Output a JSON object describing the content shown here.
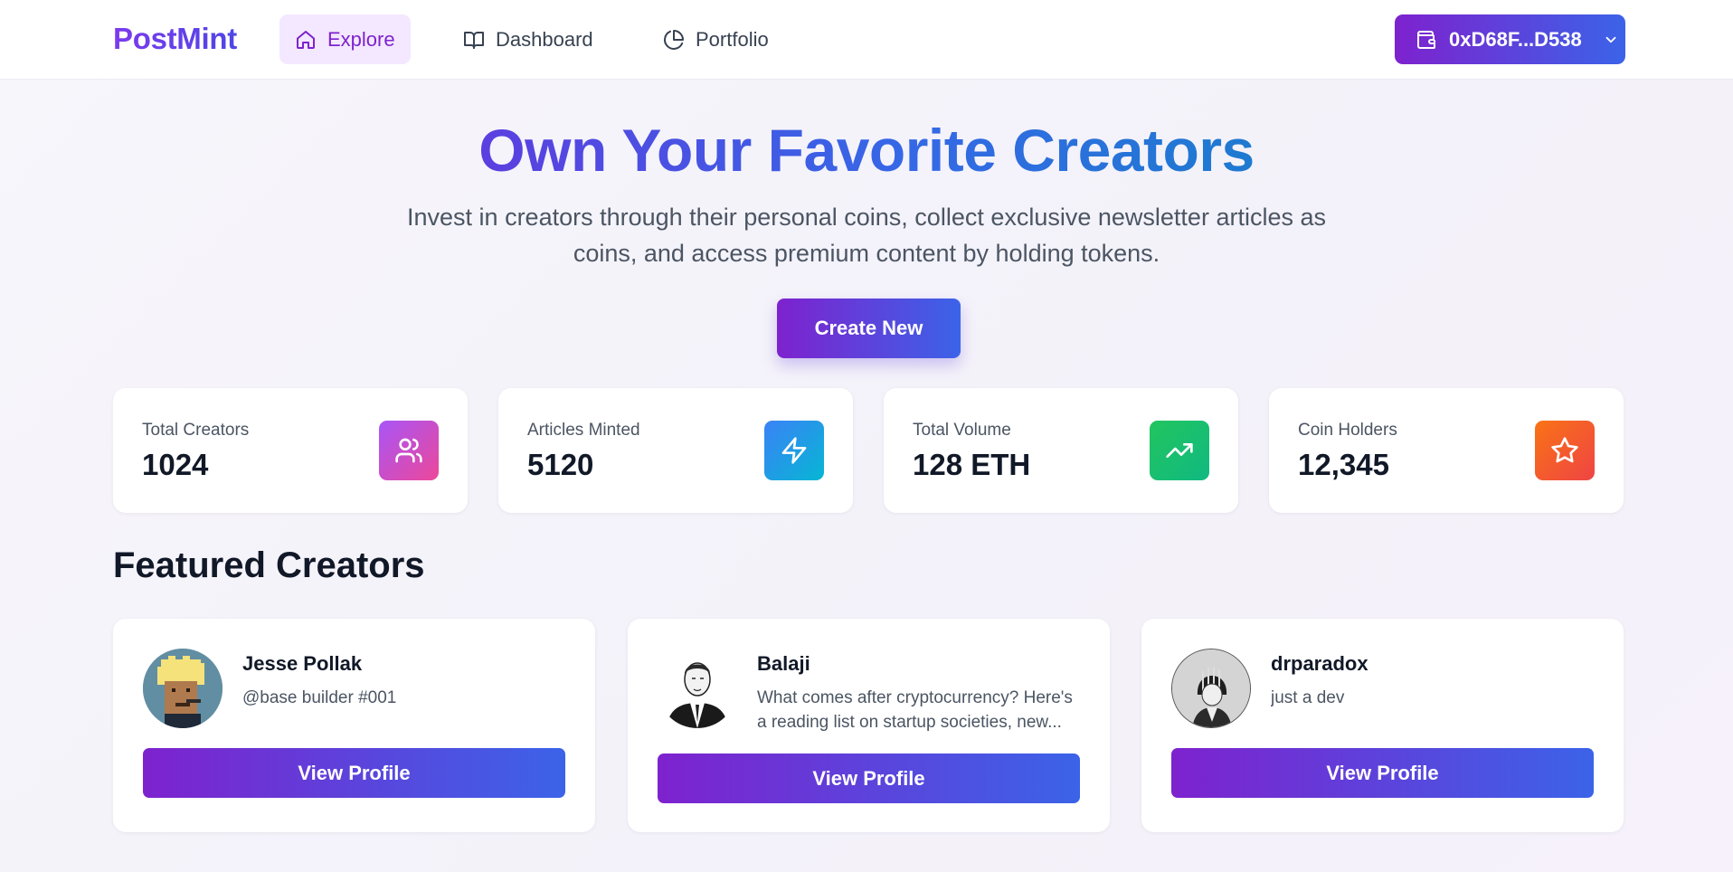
{
  "header": {
    "logo": "PostMint",
    "nav": [
      {
        "label": "Explore",
        "icon": "home-icon",
        "active": true
      },
      {
        "label": "Dashboard",
        "icon": "book-open-icon",
        "active": false
      },
      {
        "label": "Portfolio",
        "icon": "pie-chart-icon",
        "active": false
      }
    ],
    "wallet": {
      "label": "0xD68F...D538",
      "icon": "wallet-icon"
    }
  },
  "hero": {
    "title": "Own Your Favorite Creators",
    "subtitle": "Invest in creators through their personal coins, collect exclusive newsletter articles as coins, and access premium content by holding tokens.",
    "cta": "Create New"
  },
  "stats": [
    {
      "label": "Total Creators",
      "value": "1024",
      "icon": "users-icon",
      "color": "#a855f7"
    },
    {
      "label": "Articles Minted",
      "value": "5120",
      "icon": "zap-icon",
      "color": "#3b82f6"
    },
    {
      "label": "Total Volume",
      "value": "128 ETH",
      "icon": "trending-up-icon",
      "color": "#22c55e"
    },
    {
      "label": "Coin Holders",
      "value": "12,345",
      "icon": "star-icon",
      "color": "#f97316"
    }
  ],
  "featured": {
    "title": "Featured Creators",
    "creators": [
      {
        "name": "Jesse Pollak",
        "bio": "@base builder #001",
        "button": "View Profile"
      },
      {
        "name": "Balaji",
        "bio": "What comes after cryptocurrency? Here's a reading list on startup societies, new...",
        "button": "View Profile"
      },
      {
        "name": "drparadox",
        "bio": "just a dev",
        "button": "View Profile"
      }
    ]
  },
  "colors": {
    "brand_purple": "#7e22ce",
    "brand_blue": "#3b63e8",
    "nav_active_bg": "#f3e8ff"
  }
}
